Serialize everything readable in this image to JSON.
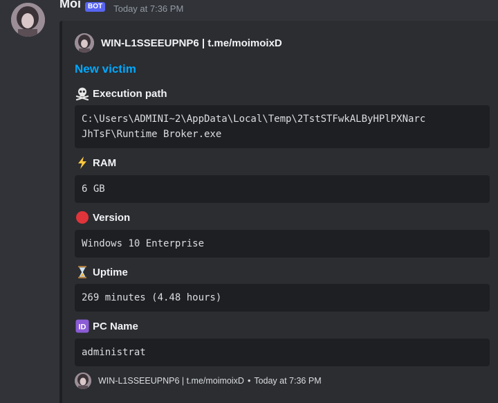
{
  "message": {
    "username": "Moi",
    "bot_tag": "BOT",
    "timestamp": "Today at 7:36 PM"
  },
  "embed": {
    "author": "WIN-L1SSEEUPNP6 | t.me/moimoixD",
    "title": "New victim",
    "fields": [
      {
        "icon": "skull-crossbones-icon",
        "name": "Execution path",
        "value": "C:\\Users\\ADMINI~2\\AppData\\Local\\Temp\\2TstSTFwkALByHPlPXNarc\nJhTsF\\Runtime Broker.exe"
      },
      {
        "icon": "lightning-icon",
        "name": "RAM",
        "value": "6 GB"
      },
      {
        "icon": "red-circle-icon",
        "name": "Version",
        "value": "Windows 10 Enterprise"
      },
      {
        "icon": "hourglass-icon",
        "name": "Uptime",
        "value": "269 minutes (4.48 hours)"
      },
      {
        "icon": "id-icon",
        "name": "PC Name",
        "value": "administrat"
      }
    ],
    "footer": {
      "text": "WIN-L1SSEEUPNP6 | t.me/moimoixD",
      "separator": "•",
      "timestamp": "Today at 7:36 PM"
    }
  },
  "colors": {
    "background": "#313338",
    "embed_background": "#2b2d31",
    "code_background": "#1e1f22",
    "title_link": "#00a8fc",
    "bot_tag": "#5865f2"
  }
}
